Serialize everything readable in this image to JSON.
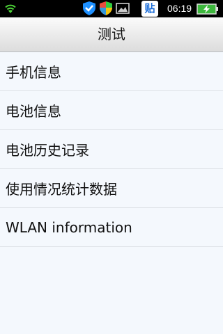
{
  "status_bar": {
    "time": "06:19",
    "icons": [
      "wifi-icon",
      "shield-icon",
      "security-shield-icon",
      "image-icon",
      "tieba-icon",
      "battery-charging-icon"
    ],
    "tieba_label": "贴",
    "colors": {
      "background": "#000000",
      "battery": "#3db83d",
      "shield": "#1e90ff",
      "tieba": "#1e6fd9"
    }
  },
  "title_bar": {
    "title": "测试"
  },
  "list": {
    "items": [
      {
        "label": "手机信息"
      },
      {
        "label": "电池信息"
      },
      {
        "label": "电池历史记录"
      },
      {
        "label": "使用情况统计数据"
      },
      {
        "label": "WLAN information"
      }
    ]
  }
}
